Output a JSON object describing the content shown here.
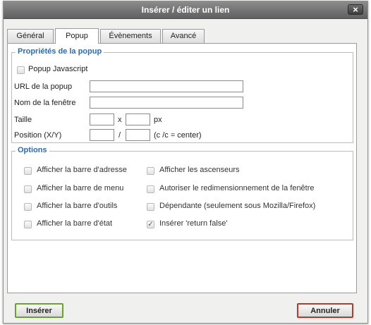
{
  "dialog": {
    "title": "Insérer / éditer un lien",
    "close_label": "×"
  },
  "tabs": [
    {
      "label": "Général"
    },
    {
      "label": "Popup"
    },
    {
      "label": "Évènements"
    },
    {
      "label": "Avancé"
    }
  ],
  "popup_props": {
    "legend": "Propriétés de la popup",
    "popup_js_label": "Popup Javascript",
    "url_label": "URL de la popup",
    "url_value": "",
    "window_name_label": "Nom de la fenêtre",
    "window_name_value": "",
    "size_label": "Taille",
    "width_value": "",
    "size_sep": "x",
    "height_value": "",
    "size_unit": "px",
    "position_label": "Position (X/Y)",
    "pos_x_value": "",
    "pos_sep": "/",
    "pos_y_value": "",
    "pos_hint": "(c /c = center)"
  },
  "options": {
    "legend": "Options",
    "items": [
      {
        "label": "Afficher la barre d'adresse",
        "checked": false,
        "mark": ""
      },
      {
        "label": "Afficher la barre de menu",
        "checked": false,
        "mark": ""
      },
      {
        "label": "Afficher la barre d'outils",
        "checked": false,
        "mark": ""
      },
      {
        "label": "Afficher la barre d'état",
        "checked": false,
        "mark": ""
      },
      {
        "label": "Afficher les ascenseurs",
        "checked": false,
        "mark": ""
      },
      {
        "label": "Autoriser le redimensionnement de la fenêtre",
        "checked": false,
        "mark": ""
      },
      {
        "label": "Dépendante (seulement sous Mozilla/Firefox)",
        "checked": false,
        "mark": ""
      },
      {
        "label": "Insérer 'return false'",
        "checked": true,
        "mark": "✓"
      }
    ]
  },
  "buttons": {
    "insert": "Insérer",
    "cancel": "Annuler"
  },
  "colors": {
    "legend": "#2b6cb0",
    "insert_border": "#6aa12b",
    "cancel_border": "#b23b2a"
  }
}
